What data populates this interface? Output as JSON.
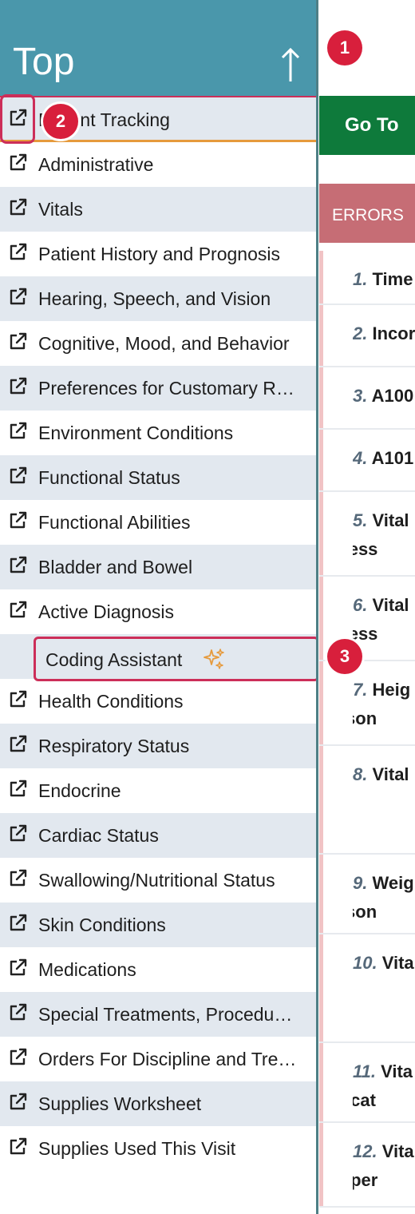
{
  "sidebar": {
    "top_label": "Top",
    "items": [
      {
        "label": "Patient Tracking"
      },
      {
        "label": "Administrative"
      },
      {
        "label": "Vitals"
      },
      {
        "label": "Patient History and Prognosis"
      },
      {
        "label": "Hearing, Speech, and Vision"
      },
      {
        "label": "Cognitive, Mood, and Behavior"
      },
      {
        "label": "Preferences for Customary R…"
      },
      {
        "label": "Environment Conditions"
      },
      {
        "label": "Functional Status"
      },
      {
        "label": "Functional Abilities"
      },
      {
        "label": "Bladder and Bowel"
      },
      {
        "label": "Active Diagnosis"
      },
      {
        "label": "Coding Assistant"
      },
      {
        "label": "Health Conditions"
      },
      {
        "label": "Respiratory Status"
      },
      {
        "label": "Endocrine"
      },
      {
        "label": "Cardiac Status"
      },
      {
        "label": "Swallowing/Nutritional Status"
      },
      {
        "label": "Skin Conditions"
      },
      {
        "label": "Medications"
      },
      {
        "label": "Special Treatments, Procedu…"
      },
      {
        "label": "Orders For Discipline and Tre…"
      },
      {
        "label": "Supplies Worksheet"
      },
      {
        "label": "Supplies Used This Visit"
      }
    ]
  },
  "callouts": [
    "1",
    "2",
    "3"
  ],
  "main": {
    "goto_label": "Go To",
    "errors_label": "ERRORS",
    "errors": [
      {
        "num": "1.",
        "line1": "Time",
        "line2": ""
      },
      {
        "num": "2.",
        "line1": "Incor",
        "line2": ""
      },
      {
        "num": "3.",
        "line1": "A100",
        "line2": ""
      },
      {
        "num": "4.",
        "line1": "A101",
        "line2": ""
      },
      {
        "num": "5.",
        "line1": "Vital",
        "line2": "assess"
      },
      {
        "num": "6.",
        "line1": "Vital",
        "line2": "assess"
      },
      {
        "num": "7.",
        "line1": "Heig",
        "line2": "reason"
      },
      {
        "num": "8.",
        "line1": "Vital",
        "line2": ""
      },
      {
        "num": "9.",
        "line1": "Weig",
        "line2": "reason"
      },
      {
        "num": "10.",
        "line1": "Vita",
        "line2": ""
      },
      {
        "num": "11.",
        "line1": "Vita",
        "line2": "indicat"
      },
      {
        "num": "12.",
        "line1": "Vita",
        "line2": "temper"
      }
    ]
  },
  "colors": {
    "header_bg": "#4a97ab",
    "highlight": "#cc2e59",
    "goto_bg": "#0e7a3b",
    "errors_bg": "#c66d75",
    "sparkle": "#e69a3c"
  }
}
